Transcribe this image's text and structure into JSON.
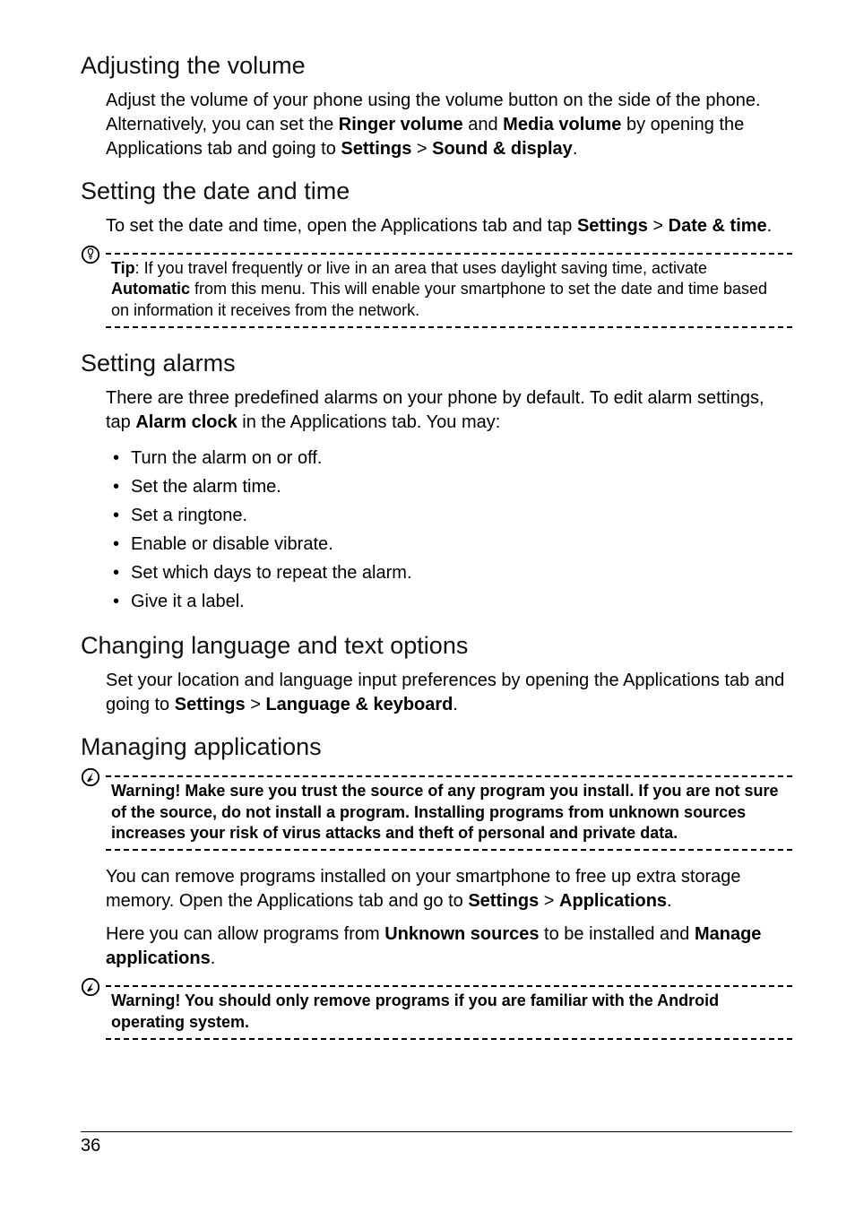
{
  "sections": {
    "adjusting_volume": {
      "title": "Adjusting the volume",
      "p1a": "Adjust the volume of your phone using the volume button on the side of the phone. Alternatively, you can set the ",
      "p1b_bold": "Ringer volume",
      "p1c": " and ",
      "p1d_bold": "Media volume",
      "p1e": " by opening the Applications tab and going to ",
      "p1f_bold": "Settings",
      "p1g": " > ",
      "p1h_bold": "Sound & display",
      "p1i": "."
    },
    "setting_date_time": {
      "title": "Setting the date and time",
      "p1a": "To set the date and time, open the Applications tab and tap ",
      "p1b_bold": "Settings",
      "p1c": " > ",
      "p1d_bold": "Date & time",
      "p1e": "."
    },
    "tip": {
      "label_bold": "Tip",
      "a": ": If you travel frequently or live in an area that uses daylight saving time, activate ",
      "b_bold": "Automatic",
      "c": " from this menu. This will enable your smartphone to set the date and time based on information it receives from the network."
    },
    "setting_alarms": {
      "title": "Setting alarms",
      "p1a": "There are three predefined alarms on your phone by default. To edit alarm settings, tap ",
      "p1b_bold": "Alarm clock",
      "p1c": " in the Applications tab. You may:",
      "items": [
        "Turn the alarm on or off.",
        "Set the alarm time.",
        "Set a ringtone.",
        "Enable or disable vibrate.",
        "Set which days to repeat the alarm.",
        "Give it a label."
      ]
    },
    "changing_language": {
      "title": "Changing language and text options",
      "p1a": "Set your location and language input preferences by opening the Applications tab and going to ",
      "p1b_bold": "Settings",
      "p1c": " > ",
      "p1d_bold": "Language & keyboard",
      "p1e": "."
    },
    "managing_apps": {
      "title": "Managing applications"
    },
    "warning1": {
      "text_bold": "Warning! Make sure you trust the source of any program you install. If you are not sure of the source, do not install a program. Installing programs from unknown sources increases your risk of virus attacks and theft of personal and private data."
    },
    "managing_apps_body": {
      "p1a": "You can remove programs installed on your smartphone to free up extra storage memory. Open the Applications tab and go to ",
      "p1b_bold": "Settings",
      "p1c": " > ",
      "p1d_bold": "Applications",
      "p1e": ".",
      "p2a": "Here you can allow programs from ",
      "p2b_bold": "Unknown sources",
      "p2c": " to be installed and ",
      "p2d_bold": "Manage applications",
      "p2e": "."
    },
    "warning2": {
      "text_bold": "Warning! You should only remove programs if you are familiar with the Android operating system."
    }
  },
  "footer": {
    "page_number": "36"
  }
}
